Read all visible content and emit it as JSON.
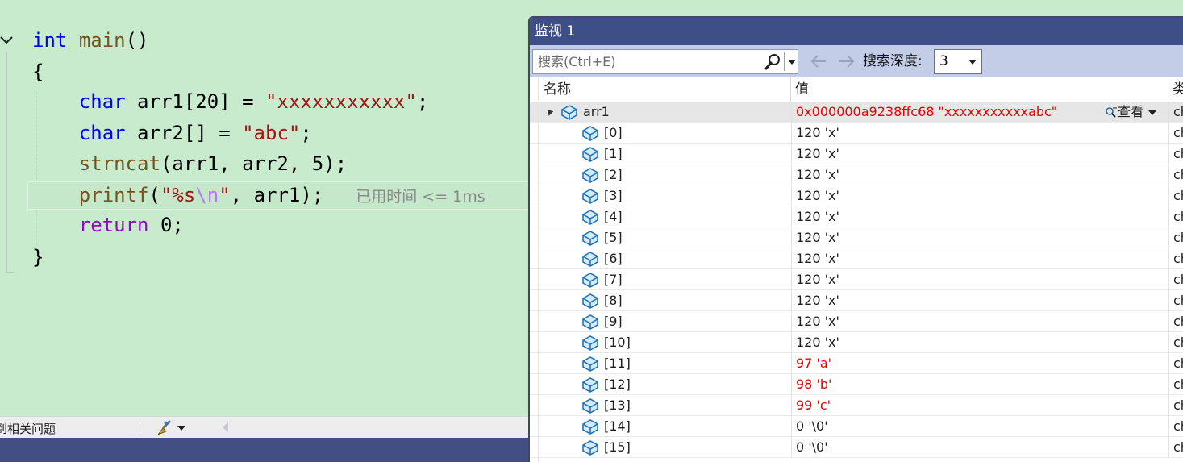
{
  "editor": {
    "lines": {
      "l1": {
        "kw": "int",
        "fn": "main",
        "rest": "()"
      },
      "l2": "{",
      "l3": {
        "kw": "char",
        "rest1": " arr1[20] = ",
        "str": "\"xxxxxxxxxxx\"",
        "end": ";"
      },
      "l4": {
        "kw": "char",
        "rest1": " arr2[] = ",
        "str": "\"abc\"",
        "end": ";"
      },
      "l5": {
        "fn": "strncat",
        "rest": "(arr1, arr2, 5);"
      },
      "l6": {
        "fn": "printf",
        "open": "(",
        "str1": "\"%s",
        "esc": "\\n",
        "str2": "\"",
        "rest": ", arr1);",
        "hint": "已用时间 <= 1ms"
      },
      "l7": {
        "kw": "return",
        "rest": " 0;"
      },
      "l8": "}"
    },
    "status_text": "到相关问题"
  },
  "watch": {
    "title": "监视 1",
    "search_placeholder": "搜索(Ctrl+E)",
    "depth_label": "搜索深度:",
    "depth_value": "3",
    "columns": {
      "name": "名称",
      "value": "值",
      "type": "类"
    },
    "parent": {
      "name": "arr1",
      "value": "0x000000a9238ffc68 \"xxxxxxxxxxxabc\"",
      "view_label": "查看",
      "type": "ch"
    },
    "rows": [
      {
        "name": "[0]",
        "value": "120 'x'",
        "type": "ch",
        "changed": false
      },
      {
        "name": "[1]",
        "value": "120 'x'",
        "type": "ch",
        "changed": false
      },
      {
        "name": "[2]",
        "value": "120 'x'",
        "type": "ch",
        "changed": false
      },
      {
        "name": "[3]",
        "value": "120 'x'",
        "type": "ch",
        "changed": false
      },
      {
        "name": "[4]",
        "value": "120 'x'",
        "type": "ch",
        "changed": false
      },
      {
        "name": "[5]",
        "value": "120 'x'",
        "type": "ch",
        "changed": false
      },
      {
        "name": "[6]",
        "value": "120 'x'",
        "type": "ch",
        "changed": false
      },
      {
        "name": "[7]",
        "value": "120 'x'",
        "type": "ch",
        "changed": false
      },
      {
        "name": "[8]",
        "value": "120 'x'",
        "type": "ch",
        "changed": false
      },
      {
        "name": "[9]",
        "value": "120 'x'",
        "type": "ch",
        "changed": false
      },
      {
        "name": "[10]",
        "value": "120 'x'",
        "type": "ch",
        "changed": false
      },
      {
        "name": "[11]",
        "value": "97 'a'",
        "type": "ch",
        "changed": true
      },
      {
        "name": "[12]",
        "value": "98 'b'",
        "type": "ch",
        "changed": true
      },
      {
        "name": "[13]",
        "value": "99 'c'",
        "type": "ch",
        "changed": true
      },
      {
        "name": "[14]",
        "value": "0 '\\0'",
        "type": "ch",
        "changed": false
      },
      {
        "name": "[15]",
        "value": "0 '\\0'",
        "type": "ch",
        "changed": false
      }
    ]
  },
  "colors": {
    "editor_bg": "#c7ebcc",
    "watch_title_bg": "#3e4e86",
    "changed_value": "#ea0000",
    "keyword": "#0000ff",
    "string": "#a31515"
  },
  "icons": {
    "collapse": "chevron-down-icon",
    "search": "magnifier-icon",
    "back": "arrow-left-icon",
    "forward": "arrow-right-icon",
    "variable": "variable-field-icon",
    "clean": "brush-icon",
    "view": "magnifier-icon"
  }
}
